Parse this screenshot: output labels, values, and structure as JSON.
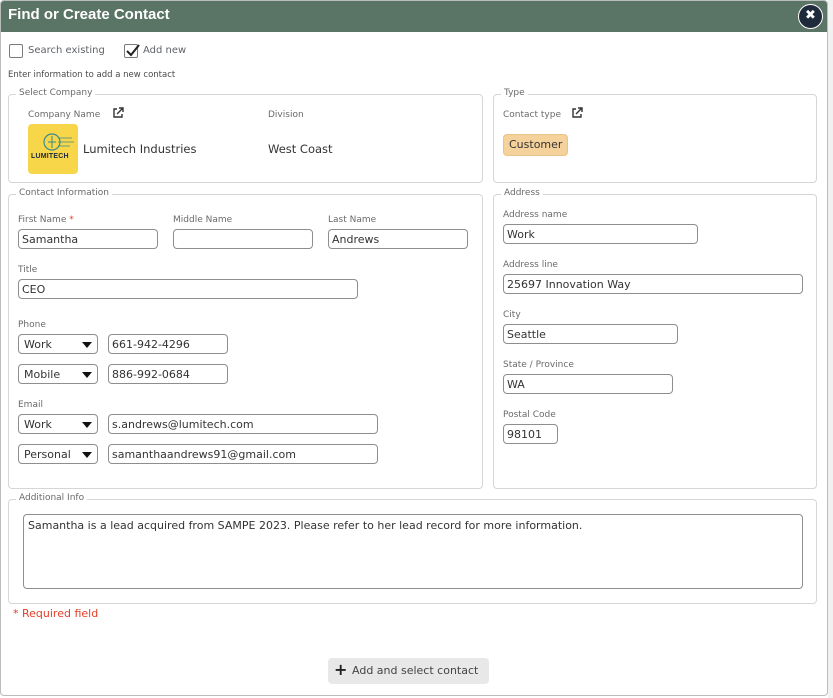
{
  "dialog": {
    "title": "Find or Create Contact",
    "close_label": "✖"
  },
  "options": {
    "search_existing_label": "Search existing",
    "search_existing_checked": false,
    "add_new_label": "Add new",
    "add_new_checked": true,
    "instruction": "Enter information to add a new contact"
  },
  "company": {
    "legend": "Select Company",
    "name_label": "Company Name",
    "name_value": "Lumitech Industries",
    "logo_text": "LUMITECH",
    "division_label": "Division",
    "division_value": "West Coast"
  },
  "type": {
    "legend": "Type",
    "contact_type_label": "Contact type",
    "contact_type_value": "Customer"
  },
  "contact": {
    "legend": "Contact Information",
    "first_name_label": "First Name",
    "first_name_required_mark": "*",
    "first_name_value": "Samantha",
    "middle_name_label": "Middle Name",
    "middle_name_value": "",
    "last_name_label": "Last Name",
    "last_name_value": "Andrews",
    "title_label": "Title",
    "title_value": "CEO",
    "phone_label": "Phone",
    "phones": [
      {
        "type": "Work",
        "value": "661-942-4296"
      },
      {
        "type": "Mobile",
        "value": "886-992-0684"
      }
    ],
    "email_label": "Email",
    "emails": [
      {
        "type": "Work",
        "value": "s.andrews@lumitech.com"
      },
      {
        "type": "Personal",
        "value": "samanthaandrews91@gmail.com"
      }
    ]
  },
  "address": {
    "legend": "Address",
    "name_label": "Address name",
    "name_value": "Work",
    "line_label": "Address line",
    "line_value": "25697 Innovation Way",
    "city_label": "City",
    "city_value": "Seattle",
    "state_label": "State / Province",
    "state_value": "WA",
    "postal_label": "Postal Code",
    "postal_value": "98101"
  },
  "additional": {
    "legend": "Additional Info",
    "notes": "Samantha is a lead acquired from SAMPE 2023. Please refer to her lead record for more information."
  },
  "footer": {
    "required_note": "* Required field",
    "add_button_label": "Add and select contact",
    "add_button_icon": "plus-icon"
  },
  "colors": {
    "titlebar": "#5a7565",
    "badge": "#f5d29b",
    "required": "#e0402a",
    "logo_bg": "#f7d64a"
  }
}
